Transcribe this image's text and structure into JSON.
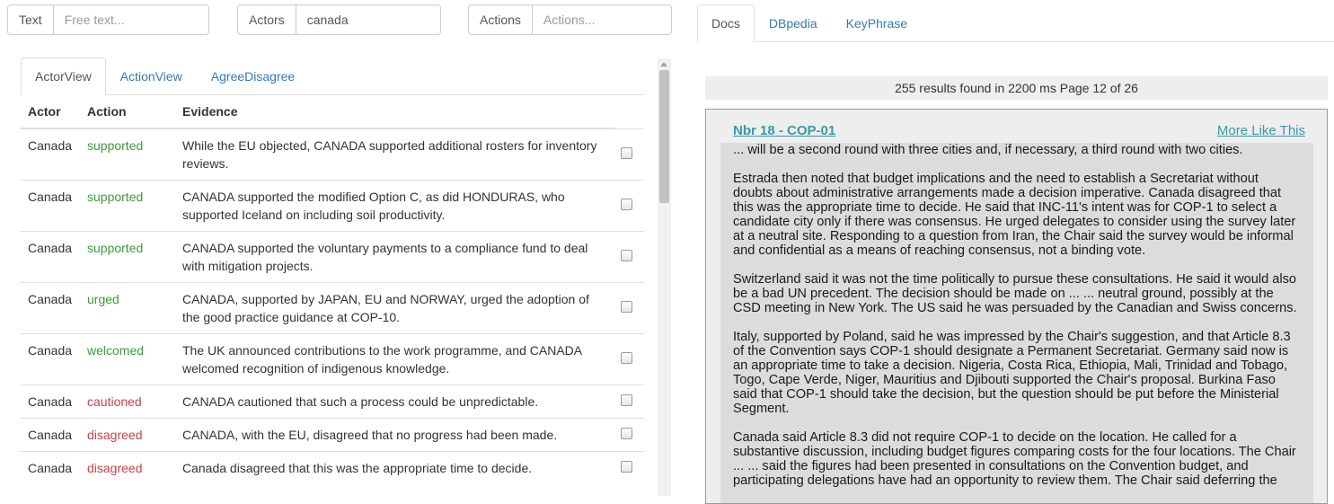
{
  "search": {
    "text": {
      "label": "Text",
      "placeholder": "Free text...",
      "value": ""
    },
    "actors": {
      "label": "Actors",
      "placeholder": "",
      "value": "canada"
    },
    "actions": {
      "label": "Actions",
      "placeholder": "Actions...",
      "value": ""
    }
  },
  "left_tabs": [
    "ActorView",
    "ActionView",
    "AgreeDisagree"
  ],
  "right_tabs": [
    "Docs",
    "DBpedia",
    "KeyPhrase"
  ],
  "table": {
    "headers": [
      "Actor",
      "Action",
      "Evidence"
    ],
    "rows": [
      {
        "actor": "Canada",
        "action": "supported",
        "evidence": "While the EU objected, CANADA supported additional rosters for inventory reviews."
      },
      {
        "actor": "Canada",
        "action": "supported",
        "evidence": "CANADA supported the modified Option C, as did HONDURAS, who supported Iceland on including soil productivity."
      },
      {
        "actor": "Canada",
        "action": "supported",
        "evidence": "CANADA supported the voluntary payments to a compliance fund to deal with mitigation projects."
      },
      {
        "actor": "Canada",
        "action": "urged",
        "evidence": "CANADA, supported by JAPAN, EU and NORWAY, urged the adoption of the good practice guidance at COP-10."
      },
      {
        "actor": "Canada",
        "action": "welcomed",
        "evidence": "The UK announced contributions to the work programme, and CANADA welcomed recognition of indigenous knowledge."
      },
      {
        "actor": "Canada",
        "action": "cautioned",
        "evidence": "CANADA cautioned that such a process could be unpredictable."
      },
      {
        "actor": "Canada",
        "action": "disagreed",
        "evidence": "CANADA, with the EU, disagreed that no progress had been made."
      },
      {
        "actor": "Canada",
        "action": "disagreed",
        "evidence": "Canada disagreed that this was the appropriate time to decide."
      }
    ]
  },
  "colors": {
    "positive_action": "#3c9a3c",
    "negative_action": "#c9404d",
    "link": "#337ab7"
  },
  "results": {
    "summary": "255 results found in 2200 ms Page 12 of 26"
  },
  "doc": {
    "title": "Nbr 18 - COP-01",
    "more_like_this": "More Like This",
    "paragraphs": [
      "... will be a second round with three cities and, if necessary, a third round with two cities.",
      "Estrada then noted that budget implications and the need to establish a Secretariat without doubts about administrative arrangements made a decision imperative. Canada disagreed that this was the appropriate time to decide. He said that INC-11's intent was for COP-1 to select a candidate city only if there was consensus. He urged delegates to consider using the survey later at a neutral site. Responding to a question from Iran, the Chair said the survey would be informal and confidential as a means of reaching consensus, not a binding vote.",
      "Switzerland said it was not the time politically to pursue these consultations. He said it would also be a bad UN precedent. The decision should be made on ... ... neutral ground, possibly at the CSD meeting in New York. The US said he was persuaded by the Canadian and Swiss concerns.",
      "Italy, supported by Poland, said he was impressed by the Chair's suggestion, and that Article 8.3 of the Convention says COP-1 should designate a Permanent Secretariat. Germany said now is an appropriate time to take a decision. Nigeria, Costa Rica, Ethiopia, Mali, Trinidad and Tobago, Togo, Cape Verde, Niger, Mauritius and Djibouti supported the Chair's proposal. Burkina Faso said that COP-1 should take the decision, but the question should be put before the Ministerial Segment.",
      "Canada said Article 8.3 did not require COP-1 to decide on the location. He called for a substantive discussion, including budget figures comparing costs for the four locations. The Chair ... ... said the figures had been presented in consultations on the Convention budget, and participating delegations have had an opportunity to review them. The Chair said deferring the"
    ]
  }
}
